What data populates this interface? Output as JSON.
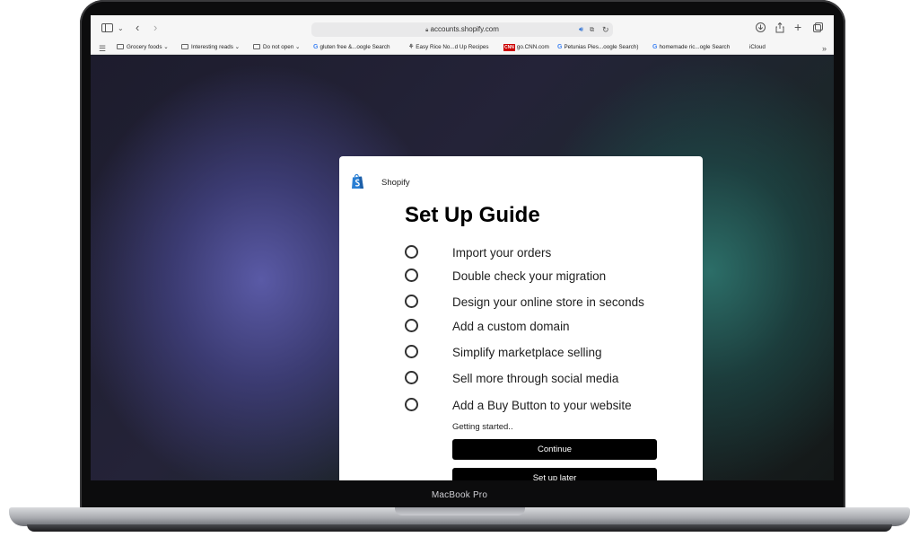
{
  "device": {
    "label": "MacBook Pro"
  },
  "browser": {
    "url": "accounts.shopify.com",
    "bookmarks": [
      {
        "label": "Grocery foods",
        "icon": "folder-icon"
      },
      {
        "label": "Interesting reads",
        "icon": "folder-icon"
      },
      {
        "label": "Do not open",
        "icon": "folder-icon"
      },
      {
        "label": "gluten free &...oogle Search",
        "icon": "google-icon"
      },
      {
        "label": "Easy Rice No...d Up Recipes",
        "icon": "recipe-icon"
      },
      {
        "label": "go.CNN.com",
        "icon": "cnn-icon"
      },
      {
        "label": "Petunias Pies...oogle Search)",
        "icon": "google-icon"
      },
      {
        "label": "homemade ric...ogle Search",
        "icon": "google-icon"
      },
      {
        "label": "iCloud",
        "icon": "apple-icon"
      }
    ]
  },
  "modal": {
    "brand": "Shopify",
    "title": "Set Up Guide",
    "tasks": [
      "Import your orders",
      "Double check your migration",
      "Design your online store in seconds",
      "Add a custom domain",
      "Simplify marketplace selling",
      "Sell more through social media",
      "Add a Buy Button to your website"
    ],
    "status": "Getting started..",
    "continue_label": "Continue",
    "later_label": "Set up later"
  },
  "colors": {
    "button": "#000000",
    "shopify_green": "#5e8e3e",
    "shopify_blue": "#2a7fd4"
  }
}
